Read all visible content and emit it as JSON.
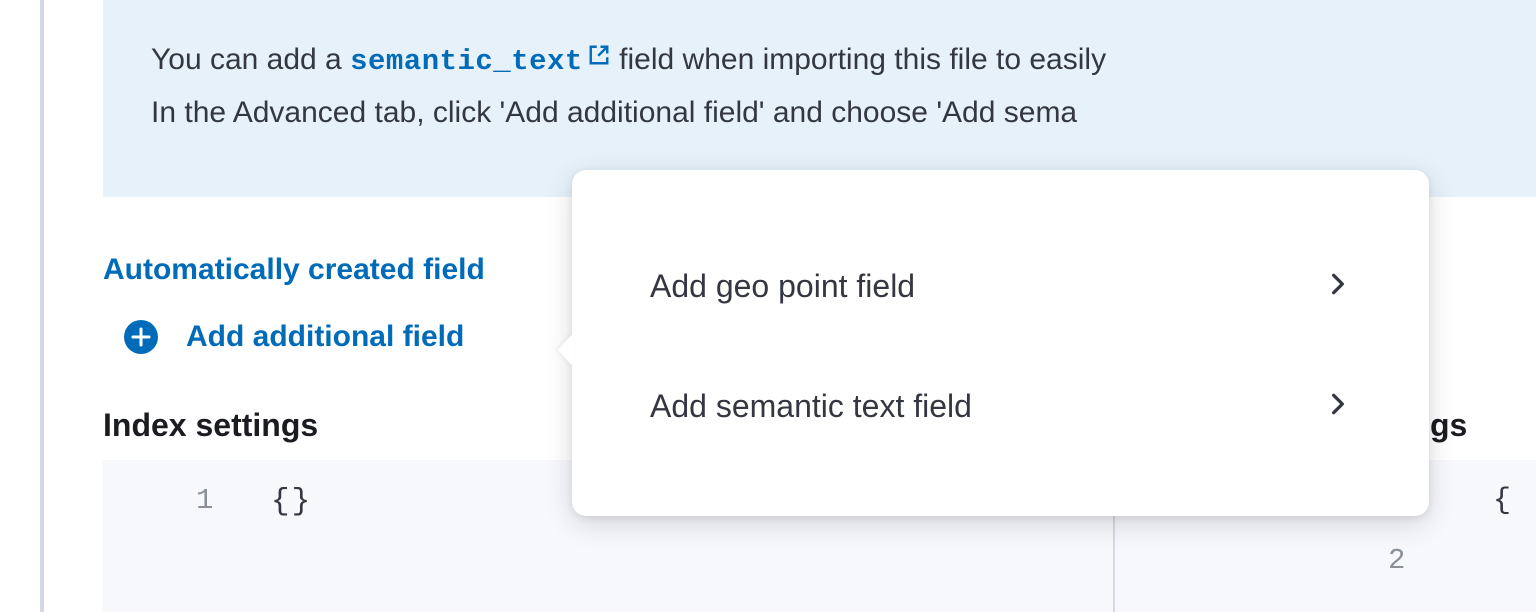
{
  "callout": {
    "line1_a": "You can add a ",
    "link_text": "semantic_text",
    "line1_b": " field when importing this file to easily",
    "line2": "In the Advanced tab, click 'Add additional field' and choose 'Add sema"
  },
  "section": {
    "auto_fields_label": "Automatically created field",
    "add_field_label": "Add additional field",
    "index_settings_heading": "Index settings",
    "right_heading_fragment": "gs"
  },
  "code_left": {
    "line_number": "1",
    "content": "{}"
  },
  "code_right": {
    "brace": "{",
    "line_number_2": "2",
    "quote": "\""
  },
  "popover": {
    "item1": "Add geo point field",
    "item2": "Add semantic text field"
  },
  "colors": {
    "link": "#006bb8",
    "callout_bg": "#e6f1fa",
    "text": "#343741"
  }
}
